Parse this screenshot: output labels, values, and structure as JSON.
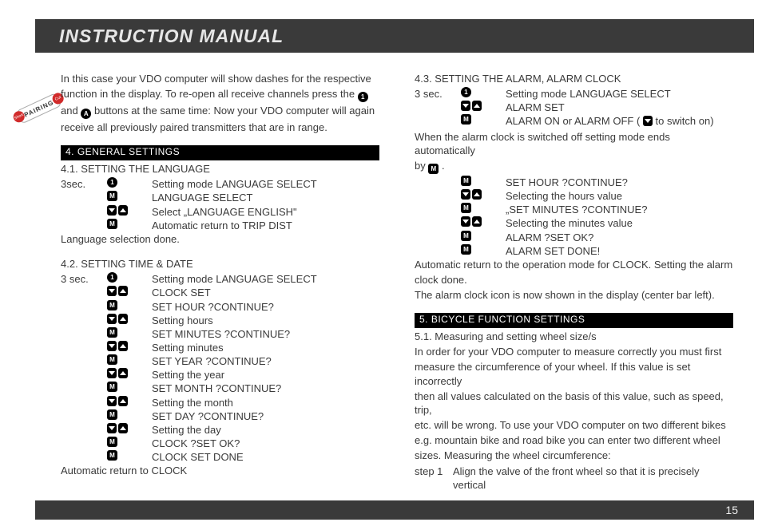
{
  "header": {
    "title": "INSTRUCTION MANUAL"
  },
  "footer": {
    "page": "15"
  },
  "badge": {
    "label": "PAIRING",
    "left": "Short",
    "right": "Cut"
  },
  "intro": {
    "l1": "In this case your VDO computer will show dashes for the respective",
    "l2a": "function in the display. To re-open all receive channels press the ",
    "l2b": "",
    "l3a": "and ",
    "l3b": " buttons at the same time: Now your VDO computer will again",
    "l4": "receive all previously paired transmitters that are in range."
  },
  "sec4": {
    "head": "4.  GENERAL SETTINGS",
    "s41": {
      "title": "4.1. SETTING THE LANGUAGE",
      "r1_a": "3sec.",
      "r1_c": "Setting mode LANGUAGE SELECT",
      "r2_c": "LANGUAGE SELECT",
      "r3_c": "Select „LANGUAGE ENGLISH\"",
      "r4_c": "Automatic return to TRIP DIST",
      "done": "Language selection done."
    },
    "s42": {
      "title": "4.2. SETTING TIME & DATE",
      "r1_a": "3 sec.",
      "r1_c": "Setting mode LANGUAGE SELECT",
      "r2_c": "CLOCK SET",
      "r3_c": "SET HOUR ?CONTINUE?",
      "r4_c": "Setting hours",
      "r5_c": "SET MINUTES ?CONTINUE?",
      "r6_c": "Setting minutes",
      "r7_c": "SET YEAR ?CONTINUE?",
      "r8_c": "Setting the year",
      "r9_c": "SET MONTH ?CONTINUE?",
      "r10_c": "Setting the month",
      "r11_c": "SET DAY ?CONTINUE?",
      "r12_c": "Setting the day",
      "r13_c": "CLOCK ?SET OK?",
      "r14_c": "CLOCK SET DONE",
      "ret": "Automatic return to CLOCK"
    },
    "s43": {
      "title": "4.3. SETTING THE ALARM, ALARM CLOCK",
      "r1_a": "3 sec.",
      "r1_c": "Setting mode LANGUAGE SELECT",
      "r2_c": "ALARM SET",
      "r3_c_a": "ALARM ON or ALARM OFF ( ",
      "r3_c_b": " to switch on)",
      "note1": "When the alarm clock is switched off setting mode ends automatically",
      "note2_a": "by ",
      "note2_b": " .",
      "r4_c": "SET HOUR ?CONTINUE?",
      "r5_c": "Selecting the hours value",
      "r6_c": "„SET MINUTES ?CONTINUE?",
      "r7_c": "Selecting the minutes value",
      "r8_c": "ALARM ?SET OK?",
      "r9_c": "ALARM SET DONE!",
      "out1": "Automatic return to the operation mode for CLOCK. Setting the alarm",
      "out2": "clock done.",
      "out3": "The alarm clock icon is now shown in the display (center bar left)."
    }
  },
  "sec5": {
    "head": "5.  BICYCLE FUNCTION SETTINGS",
    "s51": {
      "title": "5.1. Measuring and setting wheel size/s",
      "p1": "In order for your VDO computer to measure correctly you must first",
      "p2": "measure the circumference of your wheel. If this value is set incorrectly",
      "p3": "then all values calculated on the basis of this value, such as speed, trip,",
      "p4": "etc. will be wrong. To use your VDO computer on two different bikes",
      "p5": "e.g. mountain bike and road bike you can enter two different wheel",
      "p6": "sizes. Measuring the wheel circumference:",
      "step_a": "step 1",
      "step_b": "Align the valve of the front wheel so that it is precisely vertical"
    }
  },
  "icons": {
    "one": "1",
    "M": "M",
    "A": "A"
  }
}
